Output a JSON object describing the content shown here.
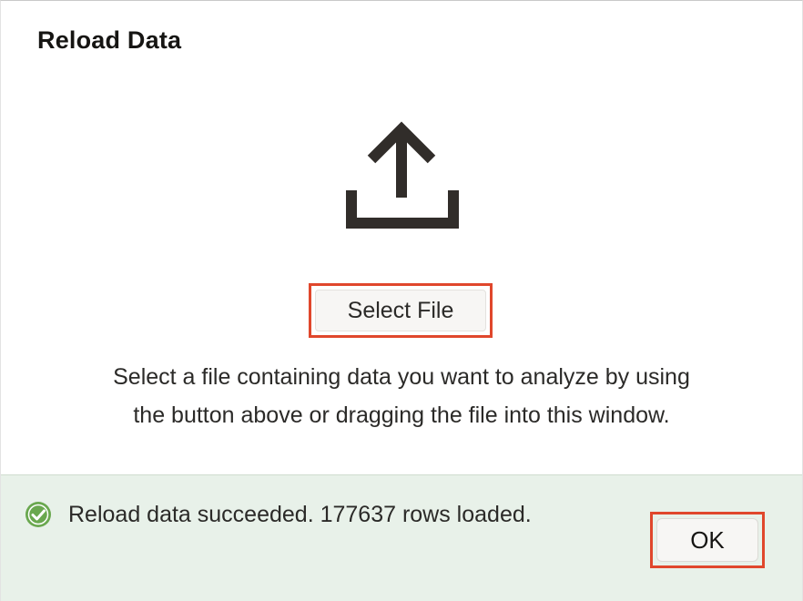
{
  "dialog": {
    "title": "Reload Data",
    "select_file_label": "Select File",
    "instructions_line1": "Select a file containing data you want to analyze by using",
    "instructions_line2": "the button above or dragging the file into this window.",
    "upload_icon": "upload-icon"
  },
  "footer": {
    "status_icon": "check-circle-icon",
    "status_text": "Reload data succeeded. 177637 rows loaded.",
    "ok_label": "OK"
  },
  "colors": {
    "highlight": "#e0472c",
    "success_bg": "#e8f1e9",
    "success_icon": "#6aa84f",
    "icon_dark": "#312d2a"
  }
}
